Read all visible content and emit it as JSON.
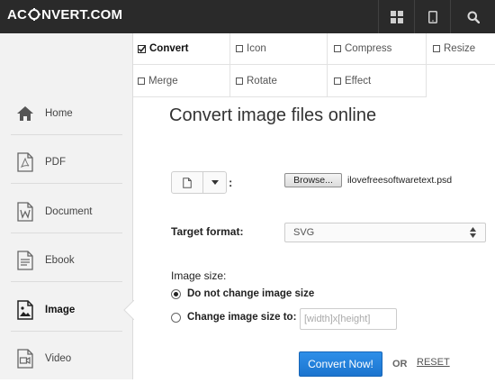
{
  "header": {
    "logo_left": "AC",
    "logo_right": "NVERT.COM",
    "icons": [
      "grid-icon",
      "tablet-icon",
      "search-icon"
    ]
  },
  "sidebar": {
    "items": [
      {
        "label": "Home",
        "icon": "home-icon"
      },
      {
        "label": "PDF",
        "icon": "pdf-icon"
      },
      {
        "label": "Document",
        "icon": "document-icon"
      },
      {
        "label": "Ebook",
        "icon": "ebook-icon"
      },
      {
        "label": "Image",
        "icon": "image-icon",
        "active": true
      },
      {
        "label": "Video",
        "icon": "video-icon"
      }
    ]
  },
  "tabs": [
    {
      "label": "Convert",
      "checked": true
    },
    {
      "label": "Icon"
    },
    {
      "label": "Compress"
    },
    {
      "label": "Resize"
    },
    {
      "label": "Merge"
    },
    {
      "label": "Rotate"
    },
    {
      "label": "Effect"
    }
  ],
  "main": {
    "title": "Convert image files online",
    "source_colon": ":",
    "browse_label": "Browse...",
    "file_name": "ilovefreesoftwaretext.psd",
    "target_format_label": "Target format:",
    "target_format_value": "SVG",
    "image_size_label": "Image size:",
    "option_keep": "Do not change image size",
    "option_change": "Change image size to:",
    "size_placeholder": "[width]x[height]",
    "convert_button": "Convert Now!",
    "or_text": "OR",
    "reset_text": "RESET"
  },
  "colors": {
    "topbar": "#2a2a2a",
    "sidebar": "#f2f2f2",
    "accent": "#1b74cf"
  }
}
